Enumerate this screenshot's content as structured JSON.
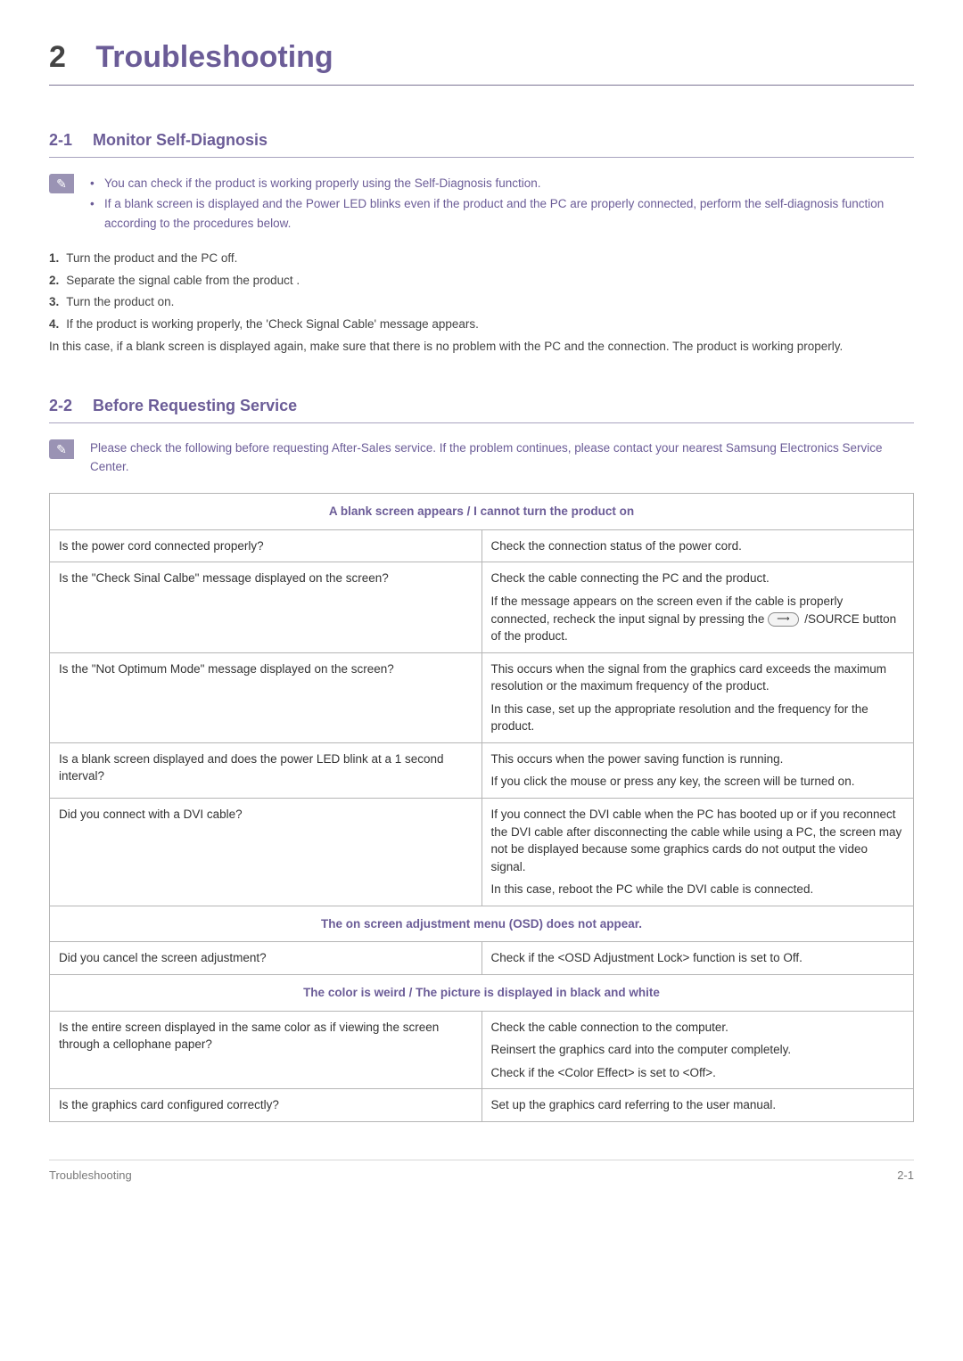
{
  "chapter": {
    "number": "2",
    "title": "Troubleshooting"
  },
  "section1": {
    "number": "2-1",
    "title": "Monitor Self-Diagnosis",
    "notes": [
      "You can check if the product is working properly using the Self-Diagnosis function.",
      "If a blank screen is displayed and the Power LED blinks even if the product and the PC are properly connected, perform the self-diagnosis function according to the procedures below."
    ],
    "steps": [
      "Turn the product and the PC off.",
      "Separate the signal cable from the product .",
      "Turn the product on.",
      "If the product is working properly, the 'Check Signal Cable' message appears."
    ],
    "after_steps": "In this case, if a blank screen is displayed again, make sure that there is no problem with the PC and the connection. The product is working properly."
  },
  "section2": {
    "number": "2-2",
    "title": "Before Requesting Service",
    "note": "Please check the following before requesting After-Sales service. If the problem continues, please contact your nearest Samsung Electronics Service Center.",
    "groups": [
      {
        "header": "A blank screen appears / I cannot turn the product on",
        "rows": [
          {
            "q": "Is the power cord connected properly?",
            "a": [
              "Check the connection status of the power cord."
            ]
          },
          {
            "q": "Is the \"Check Sinal Calbe\" message displayed on the screen?",
            "a": [
              "Check the cable connecting the PC and the product.",
              "If the message appears on the screen even if the cable is properly connected, recheck the input signal by pressing the ___SOURCE_BTN___ /SOURCE button of the product."
            ]
          },
          {
            "q": "Is the \"Not Optimum Mode\" message displayed on the screen?",
            "a": [
              "This occurs when the signal from the graphics card exceeds the maximum resolution or the maximum frequency of the product.",
              "In this case, set up the appropriate resolution and the frequency for the product."
            ]
          },
          {
            "q": "Is a blank screen displayed and does the power LED blink at a 1 second interval?",
            "a": [
              "This occurs when the power saving function is running.",
              "If you click the mouse or press any key, the screen will be turned on."
            ]
          },
          {
            "q": "Did you connect with a DVI cable?",
            "a": [
              "If you connect the DVI cable when the PC has booted up or if you reconnect the DVI cable after disconnecting the cable while using a PC, the screen may not be displayed because some graphics cards do not output the video signal.",
              "In this case, reboot the PC while the DVI cable is connected."
            ]
          }
        ]
      },
      {
        "header": "The on screen adjustment menu (OSD) does not appear.",
        "rows": [
          {
            "q": "Did you cancel the screen adjustment?",
            "a": [
              "Check if the <OSD Adjustment Lock> function is set to Off."
            ]
          }
        ]
      },
      {
        "header": "The color is weird / The picture is displayed in black and white",
        "rows": [
          {
            "q": "Is the entire screen displayed in the same color as if viewing the screen through a cellophane paper?",
            "a": [
              "Check the cable connection to the computer.",
              "Reinsert the graphics card into the computer completely.",
              "Check if the <Color Effect> is set to <Off>."
            ]
          },
          {
            "q": "Is the graphics card configured correctly?",
            "a": [
              "Set up the graphics card referring to the user manual."
            ]
          }
        ]
      }
    ]
  },
  "footer": {
    "left": "Troubleshooting",
    "right": "2-1"
  },
  "icons": {
    "note": "✎",
    "source_arrow": "⟶"
  }
}
